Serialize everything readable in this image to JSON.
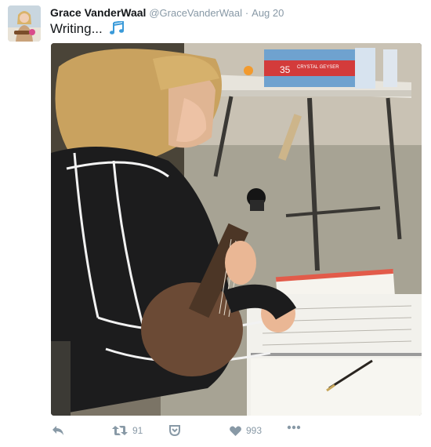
{
  "tweet": {
    "author_name": "Grace VanderWaal",
    "handle": "@GraceVanderWaal",
    "separator": "·",
    "date": "Aug 20",
    "text": "Writing...",
    "emoji_icon": "musical-notes-icon",
    "photo": {
      "water_bottle_label": "35",
      "water_bottle_brand": "CRYSTAL GEYSER"
    }
  },
  "actions": {
    "reply_icon": "reply-icon",
    "retweet_icon": "retweet-icon",
    "retweet_count": "91",
    "save_icon": "pocket-icon",
    "like_icon": "heart-icon",
    "like_count": "993",
    "more_icon": "more-icon"
  },
  "colors": {
    "name": "#14171a",
    "muted": "#8899a6",
    "accent": "#1da1f2"
  }
}
